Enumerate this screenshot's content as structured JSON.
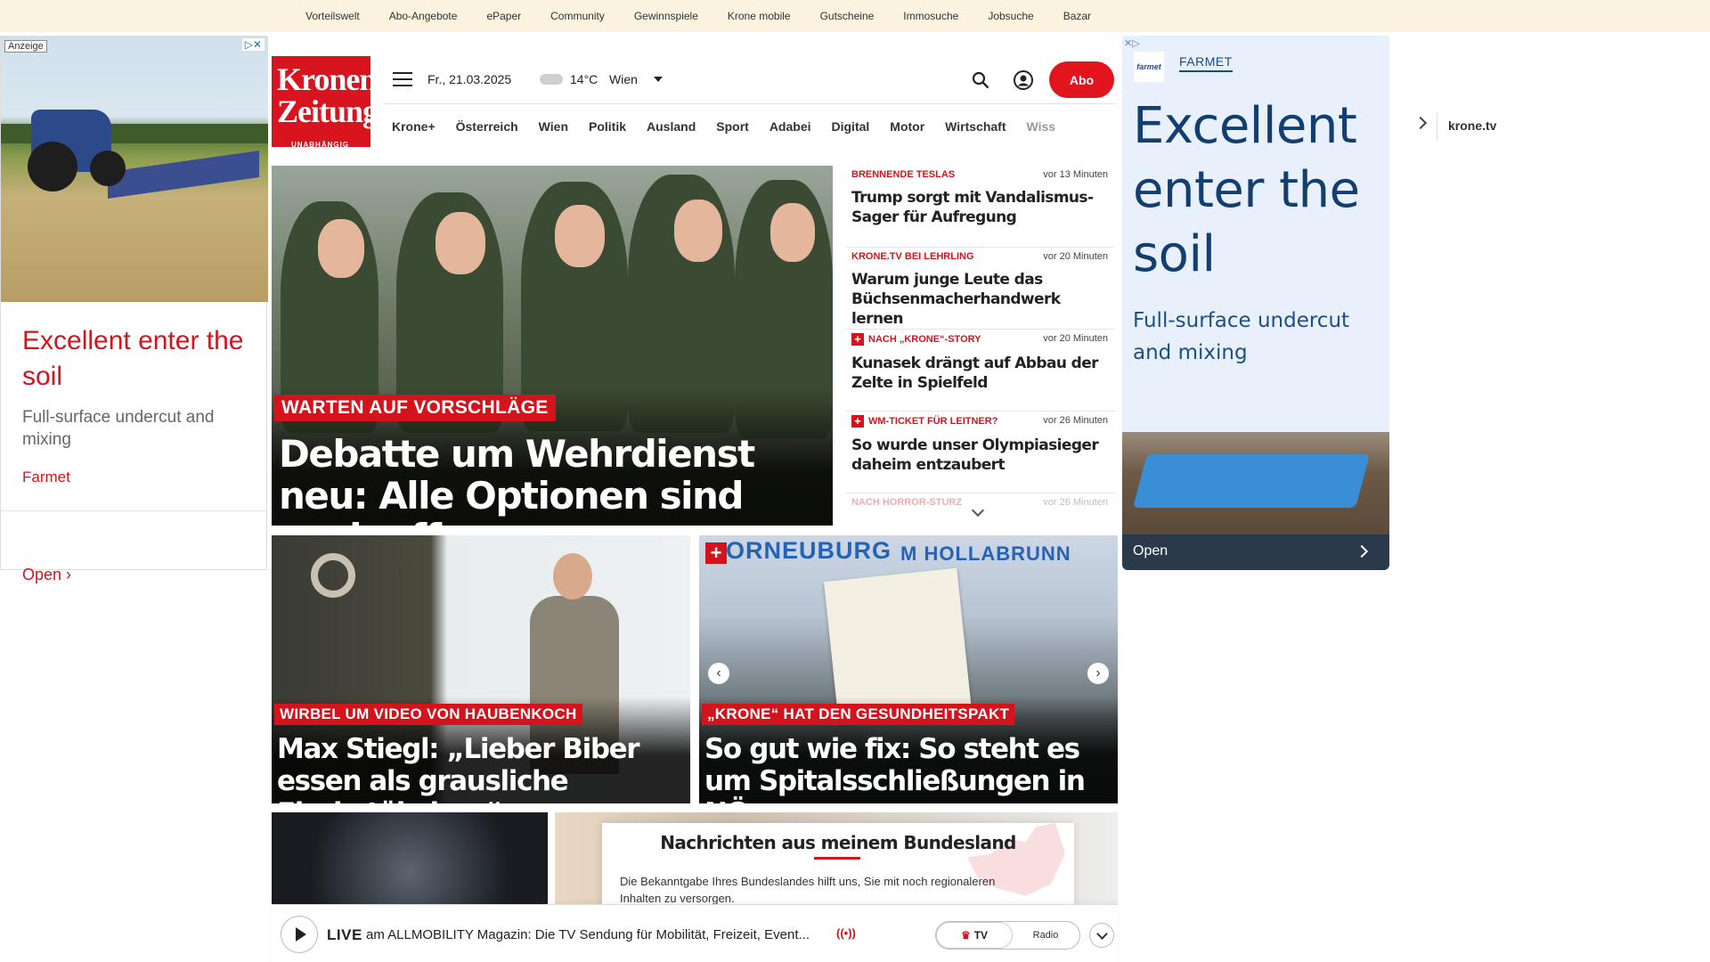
{
  "topbar": {
    "links": [
      "Vorteilswelt",
      "Abo-Angebote",
      "ePaper",
      "Community",
      "Gewinnspiele",
      "Krone mobile",
      "Gutscheine",
      "Immosuche",
      "Jobsuche",
      "Bazar"
    ]
  },
  "ad_left": {
    "label": "Anzeige",
    "adchoice": "▷✕",
    "headline": "Excellent enter the soil",
    "subline": "Full-surface undercut and mixing",
    "brand": "Farmet",
    "cta": "Open ›"
  },
  "header": {
    "logo_line1": "Kronen",
    "logo_line2": "Zeitung",
    "logo_tagline": "UNABHÄNGIG",
    "date": "Fr., 21.03.2025",
    "temperature": "14°C",
    "city": "Wien",
    "abo_label": "Abo"
  },
  "nav": {
    "items": [
      "Krone+",
      "Österreich",
      "Wien",
      "Politik",
      "Ausland",
      "Sport",
      "Adabei",
      "Digital",
      "Motor",
      "Wirtschaft",
      "Wiss"
    ],
    "tv": "krone.tv"
  },
  "hero": {
    "kicker": "WARTEN AUF VORSCHLÄGE",
    "headline": "Debatte um Wehrdienst neu: Alle Optionen sind noch offen"
  },
  "news_list": [
    {
      "kicker": "BRENNENDE TESLAS",
      "time": "vor 13 Minuten",
      "title": "Trump sorgt mit Vandalismus-Sager für Aufregung",
      "plus": false
    },
    {
      "kicker": "KRONE.TV BEI LEHRLING",
      "time": "vor 20 Minuten",
      "title": "Warum junge Leute das Büchsenmacherhandwerk lernen",
      "plus": false
    },
    {
      "kicker": "NACH „KRONE“-STORY",
      "time": "vor 20 Minuten",
      "title": "Kunasek drängt auf Abbau der Zelte in Spielfeld",
      "plus": true
    },
    {
      "kicker": "WM-TICKET FÜR LEITNER?",
      "time": "vor 26 Minuten",
      "title": "So wurde unser Olympiasieger daheim entzaubert",
      "plus": true
    },
    {
      "kicker": "NACH HORROR-STURZ",
      "time": "vor 26 Minuten",
      "title": "",
      "plus": false
    }
  ],
  "card1": {
    "kicker": "WIRBEL UM VIDEO VON HAUBENKOCH",
    "headline": "Max Stiegl: „Lieber Biber essen als grausliche Fischstäbchen“"
  },
  "card2": {
    "sign": "ORNEUBURG",
    "sign2": "M HOLLABRUNN",
    "plus": "+",
    "kicker": "„KRONE“ HAT DEN GESUNDHEITSPAKT",
    "headline": "So gut wie fix: So steht es um Spitalsschließungen in NÖ",
    "prev": "‹",
    "next": "›"
  },
  "region_modal": {
    "title": "Nachrichten aus meinem Bundesland",
    "text": "Die Bekanntgabe Ihres Bundeslandes hilft uns, Sie mit noch regionaleren Inhalten zu versorgen."
  },
  "ad_right": {
    "adchoice": "✕▷",
    "logo": "farmet",
    "brand": "FARMET",
    "headline": "Excellent enter the soil",
    "subline": "Full-surface undercut and mixing",
    "cta": "Open"
  },
  "livebar": {
    "live": "LIVE",
    "text": "am ALLMOBILITY Magazin: Die TV Sendung für Mobilität, Freizeit, Event...",
    "wave": "((•))",
    "tv": "TV",
    "radio": "Radio"
  }
}
